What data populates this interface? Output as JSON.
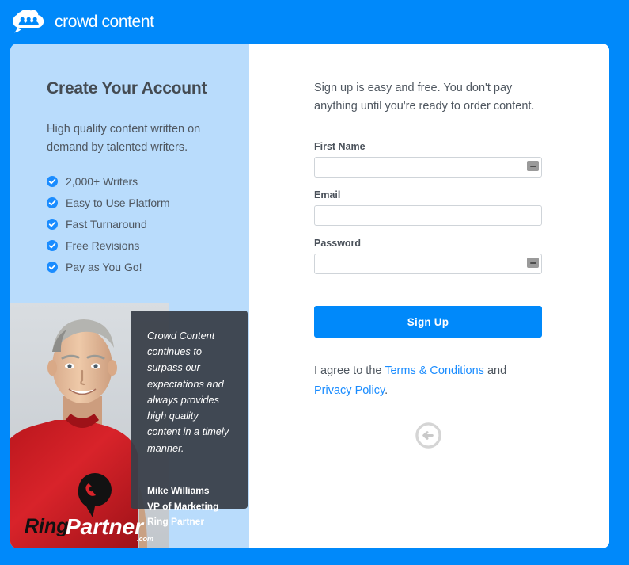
{
  "brand": {
    "name": "crowd content",
    "logo_icon": "crowd-cloud-icon",
    "accent_color": "#0089fa"
  },
  "left_panel": {
    "title": "Create Your Account",
    "subtitle": "High quality content written on demand by talented writers.",
    "background_color": "#b9dcfc",
    "check_icon_color": "#1a8cff",
    "features": [
      {
        "icon": "check-circle-icon",
        "label": "2,000+ Writers"
      },
      {
        "icon": "check-circle-icon",
        "label": "Easy to Use Platform"
      },
      {
        "icon": "check-circle-icon",
        "label": "Fast Turnaround"
      },
      {
        "icon": "check-circle-icon",
        "label": "Free Revisions"
      },
      {
        "icon": "check-circle-icon",
        "label": "Pay as You Go!"
      }
    ],
    "photo_alt": "Man in red RingPartner t-shirt",
    "testimonial": {
      "quote": "Crowd Content continues to surpass our expectations and always provides high quality content in a timely manner.",
      "author_name": "Mike Williams",
      "author_title": "VP of Marketing",
      "author_company": "Ring Partner",
      "background_color": "#383f48"
    }
  },
  "right_panel": {
    "intro": "Sign up is easy and free. You don't pay anything until you're ready to order content.",
    "fields": [
      {
        "label": "First Name",
        "value": "",
        "placeholder": "",
        "type": "text",
        "has_autofill_icon": true
      },
      {
        "label": "Email",
        "value": "",
        "placeholder": "",
        "type": "email",
        "has_autofill_icon": false
      },
      {
        "label": "Password",
        "value": "",
        "placeholder": "",
        "type": "password",
        "has_autofill_icon": true
      }
    ],
    "submit_label": "Sign Up",
    "agreement": {
      "prefix": "I agree to the ",
      "terms_link": "Terms & Conditions",
      "middle": " and ",
      "privacy_link": "Privacy Policy",
      "suffix": ".",
      "link_color": "#1a8cff"
    },
    "back_button_icon": "back-arrow-circle-icon"
  }
}
